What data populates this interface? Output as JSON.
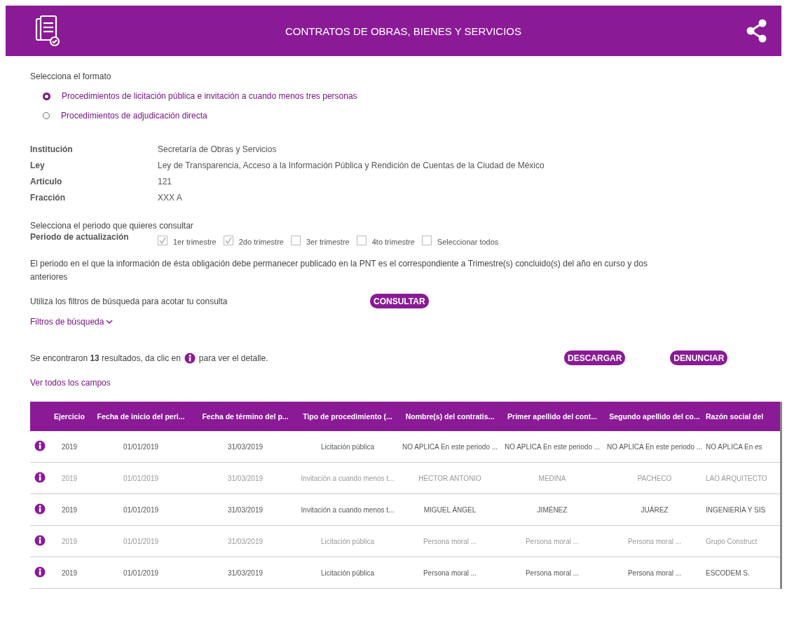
{
  "header": {
    "title": "CONTRATOS DE OBRAS, BIENES Y SERVICIOS"
  },
  "format": {
    "label": "Selecciona el formato",
    "options": [
      {
        "label": "Procedimientos de licitación pública e invitación a cuando menos tres personas",
        "selected": true
      },
      {
        "label": "Procedimientos de adjudicación directa",
        "selected": false
      }
    ]
  },
  "info": [
    {
      "label": "Institución",
      "value": "Secretaría de Obras y Servicios"
    },
    {
      "label": "Ley",
      "value": "Ley de Transparencia, Acceso a la Información Pública y Rendición de Cuentas de la Ciudad de México"
    },
    {
      "label": "Artículo",
      "value": "121"
    },
    {
      "label": "Fracción",
      "value": "XXX A"
    }
  ],
  "period": {
    "prompt": "Selecciona el periodo que quieres consultar",
    "label": "Periodo de actualización",
    "options": [
      {
        "label": "1er trimestre",
        "checked": true
      },
      {
        "label": "2do trimestre",
        "checked": true
      },
      {
        "label": "3er trimestre",
        "checked": false
      },
      {
        "label": "4to trimestre",
        "checked": false
      },
      {
        "label": "Seleccionar todos",
        "checked": false
      }
    ]
  },
  "notice": "El periodo en el que la información de ésta obligación debe permanecer publicado en la PNT es el correspondiente a Trimestre(s) concluido(s) del año en curso y dos anteriores",
  "filters": {
    "hint": "Utiliza los filtros de búsqueda para acotar tu consulta",
    "button": "CONSULTAR",
    "toggle": "Filtros de búsqueda"
  },
  "results": {
    "before": "Se encontraron **13** resultados, da clic en",
    "after": "para ver el detalle.",
    "buttons": [
      "DESCARGAR",
      "DENUNCIAR"
    ],
    "link": "Ver todos los campos"
  },
  "table": {
    "columns": [
      "Ejercicio",
      "Fecha de inicio del peri...",
      "Fecha de término del p...",
      "Tipo de procedimiento (...",
      "Nombre(s) del contratis...",
      "Primer apellido del cont...",
      "Segundo apellido del co...",
      "Razón social del"
    ],
    "rows": [
      [
        "2019",
        "01/01/2019",
        "31/03/2019",
        "Licitación pública",
        "NO APLICA En este periodo ...",
        "NO APLICA En este periodo ...",
        "NO APLICA En este periodo ...",
        "NO APLICA En es"
      ],
      [
        "2019",
        "01/01/2019",
        "31/03/2019",
        "Invitación a cuando menos t...",
        "HÉCTOR ANTONIO",
        "MEDINA",
        "PACHECO",
        "LAO ARQUITECTO"
      ],
      [
        "2019",
        "01/01/2019",
        "31/03/2019",
        "Invitación a cuando menos t...",
        "MIGUEL ÁNGEL",
        "JIMÉNEZ",
        "JUÁREZ",
        "INGENIERÍA Y SIS"
      ],
      [
        "2019",
        "01/01/2019",
        "31/03/2019",
        "Licitación pública",
        "Persona moral ...",
        "Persona moral ...",
        "Persona moral ...",
        "Grupo Construct"
      ],
      [
        "2019",
        "01/01/2019",
        "31/03/2019",
        "Licitación pública",
        "Persona moral ...",
        "Persona moral ...",
        "Persona moral ...",
        "ESCODEM S."
      ]
    ]
  }
}
